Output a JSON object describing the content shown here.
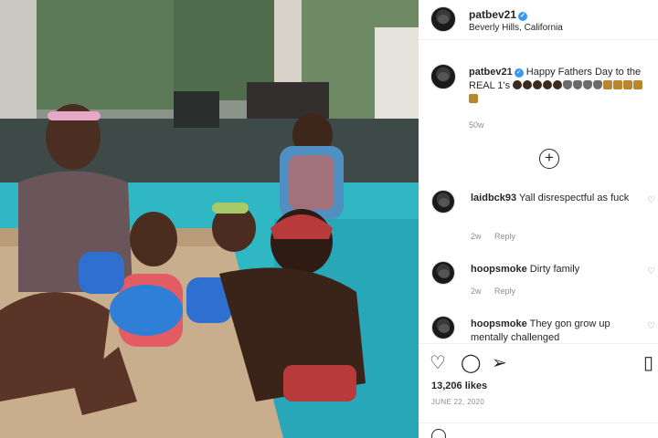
{
  "post": {
    "username": "patbev21",
    "location": "Beverly Hills, California",
    "caption_user": "patbev21",
    "caption_text": "Happy Fathers Day to the REAL 1's",
    "caption_emojis": [
      "dark",
      "dark",
      "dark",
      "dark",
      "dark",
      "pray",
      "pray",
      "pray",
      "pray",
      "gold",
      "gold",
      "gold",
      "gold",
      "gold"
    ],
    "caption_age": "50w",
    "load_more_icon": "plus-circle-icon"
  },
  "comments": [
    {
      "user": "laidbck93",
      "text": "Yall disrespectful as fuck",
      "age": "2w",
      "reply": "Reply"
    },
    {
      "user": "hoopsmoke",
      "text": "Dirty family",
      "age": "2w",
      "reply": "Reply"
    },
    {
      "user": "hoopsmoke",
      "text": "They gon grow up mentally challenged",
      "age": "",
      "reply": ""
    }
  ],
  "actions": {
    "icons": [
      "heart-icon",
      "comment-icon",
      "share-icon",
      "bookmark-icon"
    ],
    "likes": "13,206 likes",
    "date": "JUNE 22, 2020"
  },
  "colors": {
    "verified": "#3897f0",
    "pool": "#2fb8c4",
    "muted_text": "#8e8e8e"
  }
}
